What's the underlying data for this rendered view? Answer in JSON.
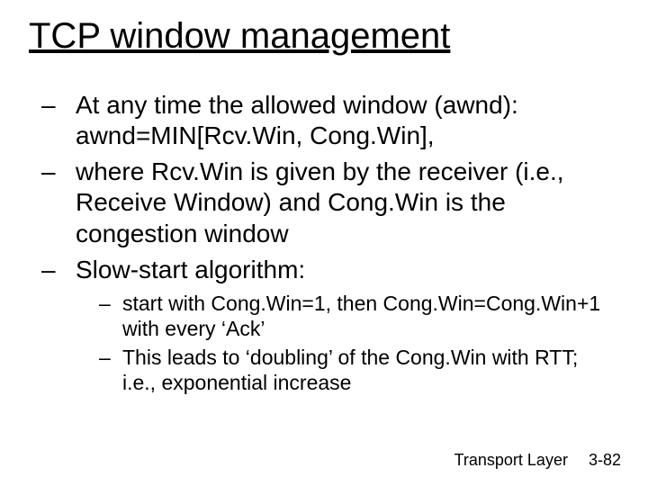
{
  "title": "TCP window management",
  "bullets": {
    "b0": "At any time the allowed window (awnd): awnd=MIN[Rcv.Win, Cong.Win],",
    "b1": "where Rcv.Win is given by the receiver (i.e., Receive Window) and Cong.Win is the congestion window",
    "b2": "Slow-start algorithm:",
    "sub0": "start with Cong.Win=1, then Cong.Win=Cong.Win+1 with every ‘Ack’",
    "sub1": "This leads to ‘doubling’ of the Cong.Win with RTT; i.e., exponential increase"
  },
  "footer": {
    "chapter": "Transport Layer",
    "page": "3-82"
  }
}
